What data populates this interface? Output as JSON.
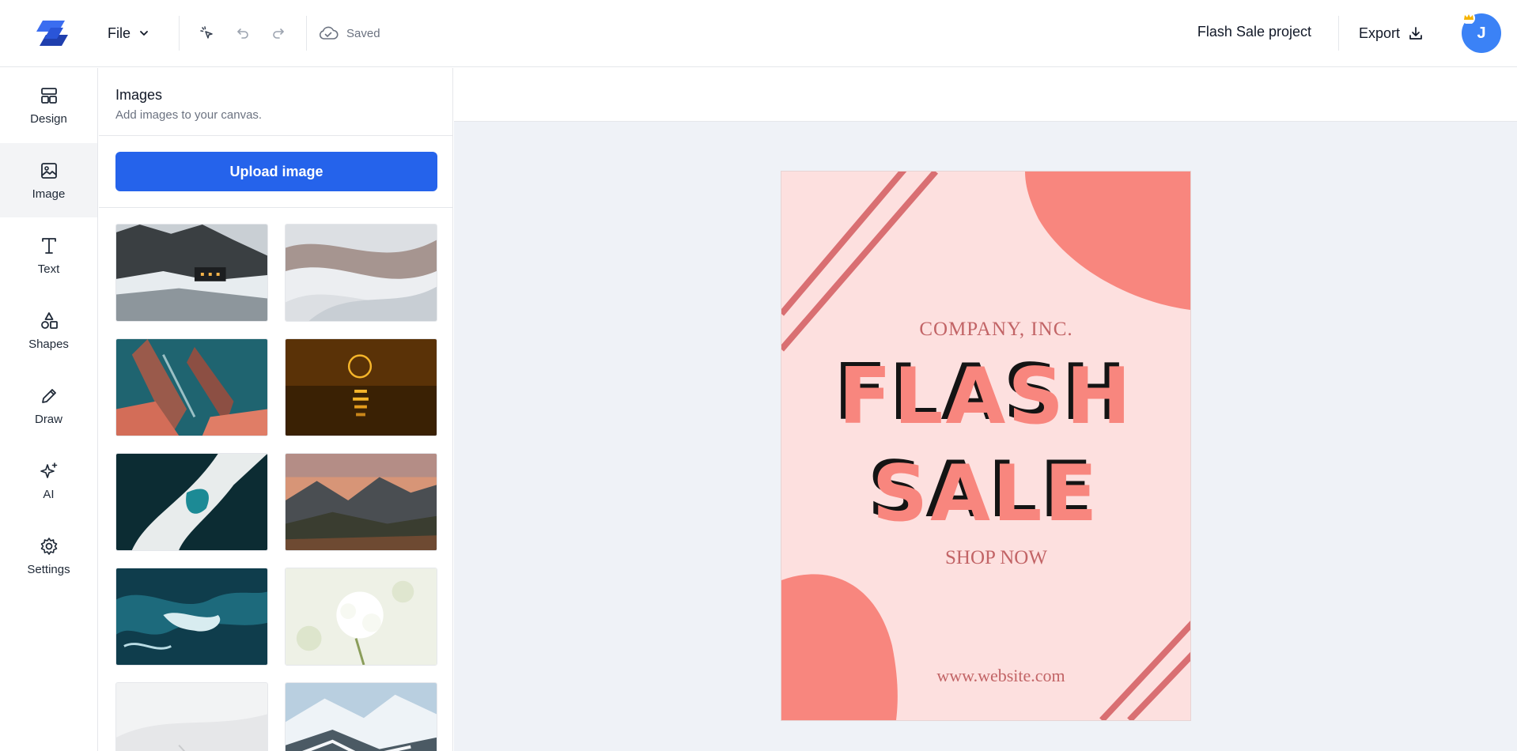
{
  "app": {
    "file_menu_label": "File",
    "saved_status": "Saved",
    "project_name": "Flash Sale project",
    "export_label": "Export",
    "user_initial": "J",
    "accent_color": "#2563eb"
  },
  "sidebar": {
    "items": [
      {
        "label": "Design",
        "icon": "layout-icon"
      },
      {
        "label": "Image",
        "icon": "image-icon",
        "active": true
      },
      {
        "label": "Text",
        "icon": "text-icon"
      },
      {
        "label": "Shapes",
        "icon": "shapes-icon"
      },
      {
        "label": "Draw",
        "icon": "pencil-icon"
      },
      {
        "label": "AI",
        "icon": "sparkles-icon"
      },
      {
        "label": "Settings",
        "icon": "gear-icon"
      }
    ]
  },
  "images_panel": {
    "title": "Images",
    "subtitle": "Add images to your canvas.",
    "upload_label": "Upload image",
    "thumbnails": [
      "mountain-cabin-snow",
      "silk-fabric-waves",
      "aerial-coast-rocks",
      "eclipse-over-water",
      "ice-cave-aerial",
      "mountain-valley-sunset",
      "ocean-waves-aerial",
      "white-blossoms",
      "snowy-slope",
      "snowy-mountains"
    ]
  },
  "poster": {
    "company": "COMPANY, INC.",
    "headline_line1": "FLASH",
    "headline_line2": "SALE",
    "cta": "SHOP NOW",
    "website": "www.website.com",
    "background_color": "#fde0df",
    "accent_color": "#f8867e"
  }
}
